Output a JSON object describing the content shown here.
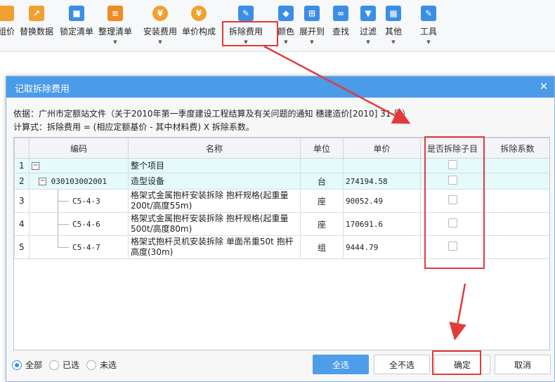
{
  "toolbar": {
    "items": [
      {
        "label": "组价",
        "icon": "group-price-icon",
        "color": "#f0a030",
        "caret": false
      },
      {
        "label": "替换数据",
        "icon": "replace-data-icon",
        "color": "#f0a030",
        "caret": false
      },
      {
        "label": "锁定清单",
        "icon": "lock-icon",
        "color": "#3a8ee6",
        "caret": false
      },
      {
        "label": "整理清单",
        "icon": "organize-list-icon",
        "color": "#f08a24",
        "caret": true
      },
      {
        "label": "安装费用",
        "icon": "install-fee-icon",
        "color": "#f0a030",
        "caret": true
      },
      {
        "label": "单价构成",
        "icon": "unit-price-icon",
        "color": "#f0a030",
        "caret": false
      },
      {
        "label": "拆除费用",
        "icon": "wrench-icon",
        "color": "#3a8ee6",
        "caret": true
      },
      {
        "label": "颜色",
        "icon": "paint-bucket-icon",
        "color": "#3a8ee6",
        "caret": true
      },
      {
        "label": "展开到",
        "icon": "expand-tree-icon",
        "color": "#3a8ee6",
        "caret": true
      },
      {
        "label": "查找",
        "icon": "binoculars-icon",
        "color": "#3a8ee6",
        "caret": false
      },
      {
        "label": "过滤",
        "icon": "filter-icon",
        "color": "#3a8ee6",
        "caret": true
      },
      {
        "label": "其他",
        "icon": "grid-icon",
        "color": "#3a8ee6",
        "caret": true
      },
      {
        "label": "工具",
        "icon": "tools-icon",
        "color": "#3a8ee6",
        "caret": true
      }
    ]
  },
  "dialog": {
    "title": "记取拆除费用",
    "close": "✕",
    "note1": "依据：广州市定额站文件（关于2010年第一季度建设工程结算及有关问题的通知 穗建造价[2010] 31 号）",
    "note2": "计算式：拆除费用 = (相应定额基价 - 其中材料费) X 拆除系数。",
    "columns": [
      "",
      "编码",
      "名称",
      "单位",
      "单价",
      "是否拆除子目",
      "拆除系数"
    ],
    "rows": [
      {
        "num": "1",
        "code": "",
        "name": "整个项目",
        "unit": "",
        "price": ""
      },
      {
        "num": "2",
        "code": "030103002001",
        "name": "造型设备",
        "unit": "台",
        "price": "274194.58"
      },
      {
        "num": "3",
        "code": "C5-4-3",
        "name": "格架式金属抱杆安装拆除 抱杆规格(起重量200t/高度55m)",
        "unit": "座",
        "price": "90052.49"
      },
      {
        "num": "4",
        "code": "C5-4-6",
        "name": "格架式金属抱杆安装拆除 抱杆规格(起重量500t/高度80m)",
        "unit": "座",
        "price": "170691.6"
      },
      {
        "num": "5",
        "code": "C5-4-7",
        "name": "格架式抱杆灵机安装拆除 单面吊重50t 抱杆高度(30m)",
        "unit": "组",
        "price": "9444.79"
      }
    ],
    "filter": {
      "all": "全部",
      "selected": "已选",
      "unselected": "未选"
    },
    "buttons": {
      "select_all": "全选",
      "select_none": "全不选",
      "ok": "确定",
      "cancel": "取消"
    }
  },
  "annotation_color": "#e23a3a"
}
